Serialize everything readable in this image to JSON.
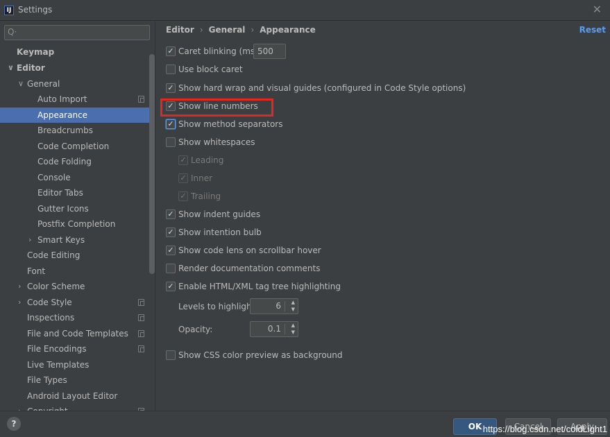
{
  "window": {
    "title": "Settings",
    "app_icon_letter": "IJ",
    "close_glyph": "✕"
  },
  "sidebar": {
    "search_glyph": "Q·",
    "items": [
      {
        "label": "Keymap"
      },
      {
        "label": "Editor",
        "arrow": "∨"
      },
      {
        "label": "General",
        "arrow": "∨"
      },
      {
        "label": "Auto Import"
      },
      {
        "label": "Appearance"
      },
      {
        "label": "Breadcrumbs"
      },
      {
        "label": "Code Completion"
      },
      {
        "label": "Code Folding"
      },
      {
        "label": "Console"
      },
      {
        "label": "Editor Tabs"
      },
      {
        "label": "Gutter Icons"
      },
      {
        "label": "Postfix Completion"
      },
      {
        "label": "Smart Keys",
        "arrow": "›"
      },
      {
        "label": "Code Editing"
      },
      {
        "label": "Font"
      },
      {
        "label": "Color Scheme",
        "arrow": "›"
      },
      {
        "label": "Code Style",
        "arrow": "›"
      },
      {
        "label": "Inspections"
      },
      {
        "label": "File and Code Templates"
      },
      {
        "label": "File Encodings"
      },
      {
        "label": "Live Templates"
      },
      {
        "label": "File Types"
      },
      {
        "label": "Android Layout Editor"
      },
      {
        "label": "Copyright",
        "arrow": "›"
      }
    ]
  },
  "breadcrumb": {
    "part1": "Editor",
    "part2": "General",
    "part3": "Appearance",
    "separator": "›"
  },
  "reset_label": "Reset",
  "check_glyph": "✓",
  "options": [
    {
      "label": "Caret blinking (ms):",
      "checked": true,
      "value": "500"
    },
    {
      "label": "Use block caret",
      "checked": false
    },
    {
      "label": "Show hard wrap and visual guides (configured in Code Style options)",
      "checked": true
    },
    {
      "label": "Show line numbers",
      "checked": true
    },
    {
      "label": "Show method separators",
      "checked": true
    },
    {
      "label": "Show whitespaces",
      "checked": false
    },
    {
      "label": "Leading",
      "checked": true,
      "disabled": true
    },
    {
      "label": "Inner",
      "checked": true,
      "disabled": true
    },
    {
      "label": "Trailing",
      "checked": true,
      "disabled": true
    },
    {
      "label": "Show indent guides",
      "checked": true
    },
    {
      "label": "Show intention bulb",
      "checked": true
    },
    {
      "label": "Show code lens on scrollbar hover",
      "checked": true
    },
    {
      "label": "Render documentation comments",
      "checked": false
    },
    {
      "label": "Enable HTML/XML tag tree highlighting",
      "checked": true
    },
    {
      "label": "Show CSS color preview as background",
      "checked": false
    }
  ],
  "levels": {
    "label": "Levels to highlight:",
    "value": "6"
  },
  "opacity": {
    "label": "Opacity:",
    "value": "0.1"
  },
  "spin_up": "▲",
  "spin_down": "▼",
  "footer": {
    "help_label": "?",
    "ok_label": "OK",
    "cancel_label": "Cancel",
    "apply_label": "Apply",
    "watermark": "https://blog.csdn.net/coldLight1"
  },
  "colors": {
    "accent": "#4b6eaf",
    "link": "#589df6",
    "highlight_box": "#e5281f"
  }
}
